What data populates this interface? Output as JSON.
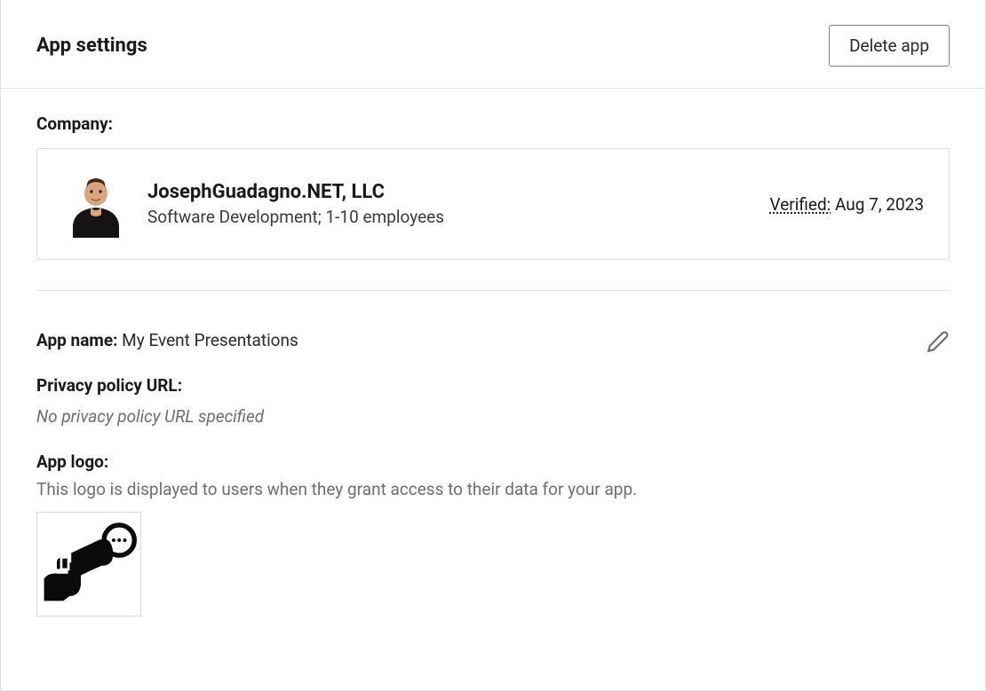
{
  "header": {
    "title": "App settings",
    "delete_button": "Delete app"
  },
  "company": {
    "section_label": "Company:",
    "name": "JosephGuadagno.NET, LLC",
    "meta": "Software Development; 1-10 employees",
    "verified_label": "Verified:",
    "verified_date": "Aug 7, 2023"
  },
  "app_name": {
    "label": "App name:",
    "value": "My Event Presentations"
  },
  "privacy_policy": {
    "label": "Privacy policy URL:",
    "empty_text": "No privacy policy URL specified"
  },
  "app_logo": {
    "label": "App logo:",
    "description": "This logo is displayed to users when they grant access to their data for your app."
  }
}
